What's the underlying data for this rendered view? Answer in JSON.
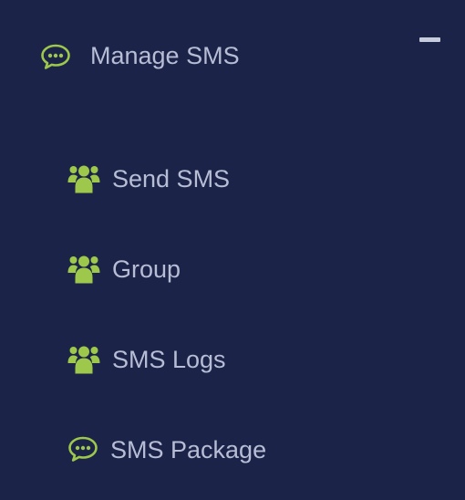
{
  "menu": {
    "title": "Manage SMS",
    "title_icon": "chat-bubble-icon",
    "collapse_icon": "minus-icon",
    "accent_color": "#9dc84c",
    "background_color": "#1b2349",
    "text_color": "#b6bdd4",
    "items": [
      {
        "label": "Send SMS",
        "icon": "users-group-icon"
      },
      {
        "label": "Group",
        "icon": "users-group-icon"
      },
      {
        "label": "SMS Logs",
        "icon": "users-group-icon"
      },
      {
        "label": "SMS Package",
        "icon": "chat-bubble-icon"
      }
    ]
  }
}
